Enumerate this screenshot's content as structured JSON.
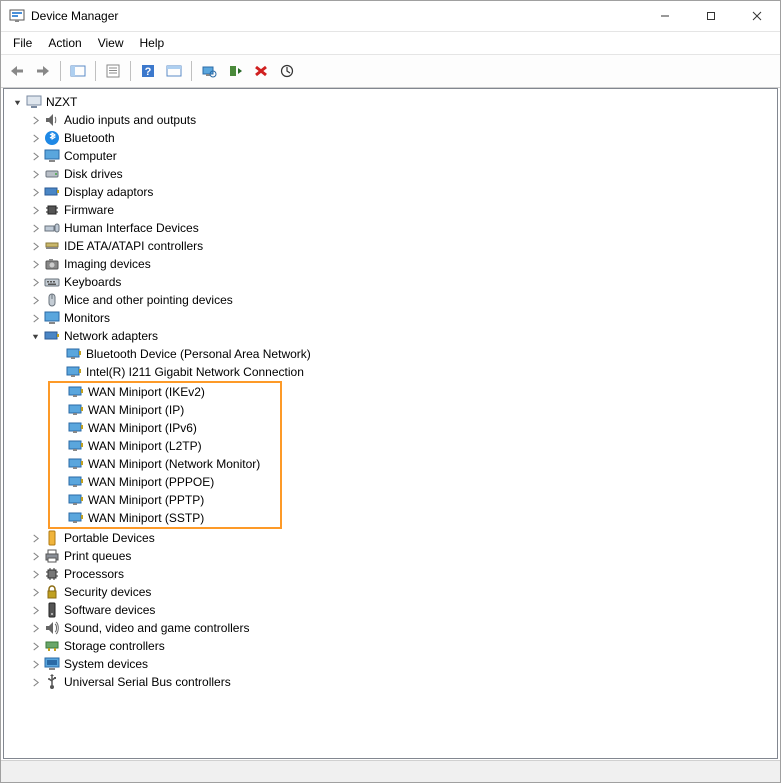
{
  "window": {
    "title": "Device Manager"
  },
  "menu": {
    "file": "File",
    "action": "Action",
    "view": "View",
    "help": "Help"
  },
  "root": {
    "name": "NZXT"
  },
  "nodes": {
    "audio": "Audio inputs and outputs",
    "bluetooth": "Bluetooth",
    "computer": "Computer",
    "disk": "Disk drives",
    "display": "Display adaptors",
    "firmware": "Firmware",
    "hid": "Human Interface Devices",
    "ide": "IDE ATA/ATAPI controllers",
    "imaging": "Imaging devices",
    "keyboards": "Keyboards",
    "mice": "Mice and other pointing devices",
    "monitors": "Monitors",
    "network": "Network adapters",
    "portable": "Portable Devices",
    "printq": "Print queues",
    "processors": "Processors",
    "security": "Security devices",
    "software": "Software devices",
    "sound": "Sound, video and game controllers",
    "storage": "Storage controllers",
    "system": "System devices",
    "usb": "Universal Serial Bus controllers"
  },
  "netchildren": {
    "btpan": "Bluetooth Device (Personal Area Network)",
    "i211": "Intel(R) I211 Gigabit Network Connection",
    "ikev2": "WAN Miniport (IKEv2)",
    "ip": "WAN Miniport (IP)",
    "ipv6": "WAN Miniport (IPv6)",
    "l2tp": "WAN Miniport (L2TP)",
    "netmon": "WAN Miniport (Network Monitor)",
    "pppoe": "WAN Miniport (PPPOE)",
    "pptp": "WAN Miniport (PPTP)",
    "sstp": "WAN Miniport (SSTP)"
  },
  "highlight_color": "#fd9a28"
}
